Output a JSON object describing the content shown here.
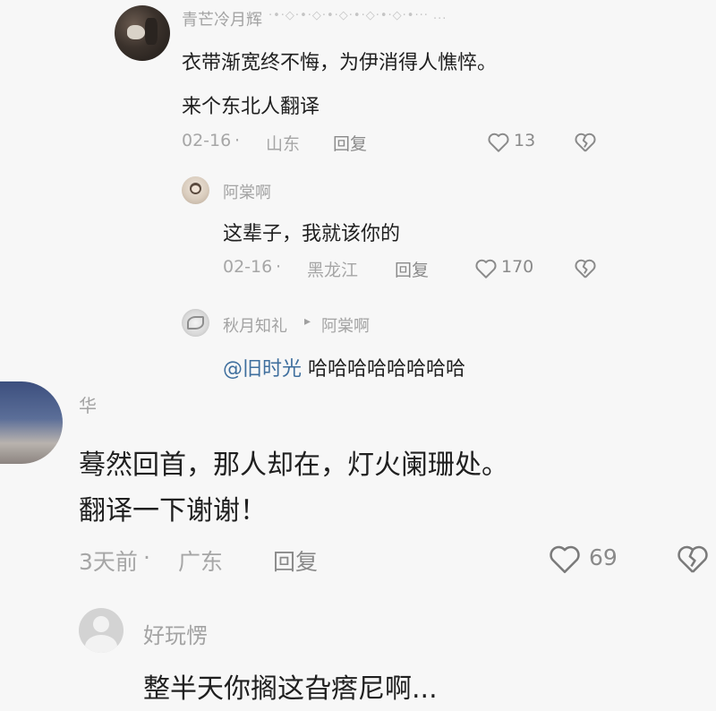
{
  "comments": [
    {
      "user": "青芒冷月辉",
      "badge_deco": "·•·◇·•·◇·•·◇·•·◇·•·◇·•··· ...",
      "lines": [
        "衣带渐宽终不悔，为伊消得人憔悴。",
        "来个东北人翻译"
      ],
      "date": "02-16",
      "location": "山东",
      "reply_label": "回复",
      "likes": "13",
      "replies": [
        {
          "user": "阿棠啊",
          "text": "这辈子，我就该你的",
          "date": "02-16",
          "location": "黑龙江",
          "reply_label": "回复",
          "likes": "170"
        },
        {
          "user": "秋月知礼",
          "reply_arrow": "▸",
          "reply_to": "阿棠啊",
          "mention": "@旧时光",
          "text": " 哈哈哈哈哈哈哈哈"
        }
      ]
    },
    {
      "user": "华",
      "lines": [
        "蓦然回首，那人却在，灯火阑珊处。",
        "翻译一下谢谢！"
      ],
      "date": "3天前",
      "location": "广东",
      "reply_label": "回复",
      "likes": "69"
    },
    {
      "user": "好玩愣",
      "lines": [
        "整半天你搁这旮瘩尼啊..."
      ]
    }
  ],
  "separator": " · ",
  "icons": {
    "like": "heart-outline-icon",
    "dislike": "broken-heart-icon",
    "default_avatar": "person-silhouette-icon"
  },
  "colors": {
    "mention": "#3f6f9e",
    "muted": "#a6a6a6",
    "text": "#1f1f1f",
    "background": "#f7f7f7"
  }
}
